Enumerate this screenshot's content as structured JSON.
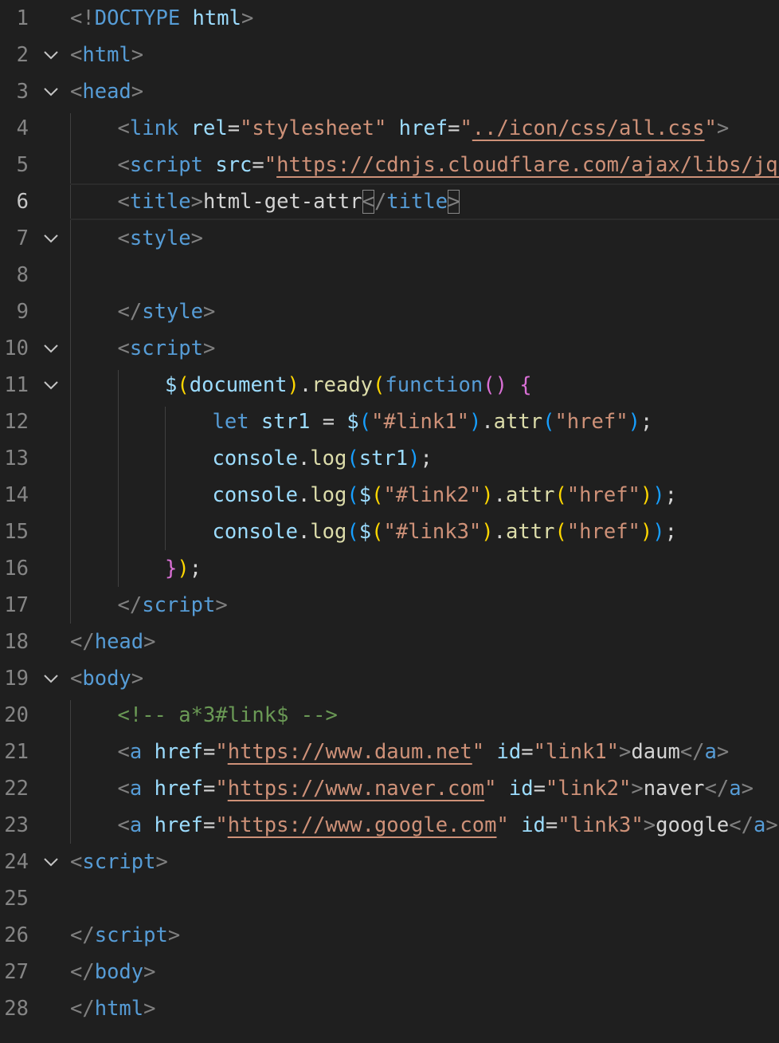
{
  "editor": {
    "active_line": 6,
    "lines": [
      {
        "n": "1",
        "fold": false,
        "indent": 0,
        "tokens": [
          [
            "p",
            "<!"
          ],
          [
            "tag",
            "DOCTYPE"
          ],
          [
            "txt",
            " "
          ],
          [
            "attr",
            "html"
          ],
          [
            "p",
            ">"
          ]
        ]
      },
      {
        "n": "2",
        "fold": true,
        "indent": 0,
        "tokens": [
          [
            "p",
            "<"
          ],
          [
            "tag",
            "html"
          ],
          [
            "p",
            ">"
          ]
        ]
      },
      {
        "n": "3",
        "fold": true,
        "indent": 0,
        "tokens": [
          [
            "p",
            "<"
          ],
          [
            "tag",
            "head"
          ],
          [
            "p",
            ">"
          ]
        ]
      },
      {
        "n": "4",
        "fold": false,
        "indent": 1,
        "tokens": [
          [
            "p",
            "<"
          ],
          [
            "tag",
            "link"
          ],
          [
            "txt",
            " "
          ],
          [
            "attr",
            "rel"
          ],
          [
            "txt",
            "="
          ],
          [
            "str",
            "\"stylesheet\""
          ],
          [
            "txt",
            " "
          ],
          [
            "attr",
            "href"
          ],
          [
            "txt",
            "="
          ],
          [
            "str",
            "\""
          ],
          [
            "url",
            "../icon/css/all.css"
          ],
          [
            "str",
            "\""
          ],
          [
            "p",
            ">"
          ]
        ]
      },
      {
        "n": "5",
        "fold": false,
        "indent": 1,
        "tokens": [
          [
            "p",
            "<"
          ],
          [
            "tag",
            "script"
          ],
          [
            "txt",
            " "
          ],
          [
            "attr",
            "src"
          ],
          [
            "txt",
            "="
          ],
          [
            "str",
            "\""
          ],
          [
            "url",
            "https://cdnjs.cloudflare.com/ajax/libs/jque"
          ]
        ]
      },
      {
        "n": "6",
        "fold": false,
        "indent": 1,
        "tokens": [
          [
            "p",
            "<"
          ],
          [
            "tag",
            "title"
          ],
          [
            "p",
            ">"
          ],
          [
            "txt",
            "html-get-attr"
          ],
          [
            "pm",
            "<"
          ],
          [
            "p",
            "/"
          ],
          [
            "tag",
            "title"
          ],
          [
            "pm",
            ">"
          ]
        ]
      },
      {
        "n": "7",
        "fold": true,
        "indent": 1,
        "tokens": [
          [
            "p",
            "<"
          ],
          [
            "tag",
            "style"
          ],
          [
            "p",
            ">"
          ]
        ]
      },
      {
        "n": "8",
        "fold": false,
        "indent": 1,
        "tokens": []
      },
      {
        "n": "9",
        "fold": false,
        "indent": 1,
        "tokens": [
          [
            "p",
            "</"
          ],
          [
            "tag",
            "style"
          ],
          [
            "p",
            ">"
          ]
        ]
      },
      {
        "n": "10",
        "fold": true,
        "indent": 1,
        "tokens": [
          [
            "p",
            "<"
          ],
          [
            "tag",
            "script"
          ],
          [
            "p",
            ">"
          ]
        ]
      },
      {
        "n": "11",
        "fold": true,
        "indent": 2,
        "tokens": [
          [
            "attr",
            "$"
          ],
          [
            "br1",
            "("
          ],
          [
            "attr",
            "document"
          ],
          [
            "br1",
            ")"
          ],
          [
            "txt",
            "."
          ],
          [
            "fn",
            "ready"
          ],
          [
            "br1",
            "("
          ],
          [
            "kw",
            "function"
          ],
          [
            "br2",
            "()"
          ],
          [
            "txt",
            " "
          ],
          [
            "br2",
            "{"
          ]
        ]
      },
      {
        "n": "12",
        "fold": false,
        "indent": 3,
        "tokens": [
          [
            "kw",
            "let"
          ],
          [
            "txt",
            " "
          ],
          [
            "attr",
            "str1"
          ],
          [
            "txt",
            " = "
          ],
          [
            "attr",
            "$"
          ],
          [
            "br3",
            "("
          ],
          [
            "str",
            "\"#link1\""
          ],
          [
            "br3",
            ")"
          ],
          [
            "txt",
            "."
          ],
          [
            "fn",
            "attr"
          ],
          [
            "br3",
            "("
          ],
          [
            "str",
            "\"href\""
          ],
          [
            "br3",
            ")"
          ],
          [
            "txt",
            ";"
          ]
        ]
      },
      {
        "n": "13",
        "fold": false,
        "indent": 3,
        "tokens": [
          [
            "attr",
            "console"
          ],
          [
            "txt",
            "."
          ],
          [
            "fn",
            "log"
          ],
          [
            "br3",
            "("
          ],
          [
            "attr",
            "str1"
          ],
          [
            "br3",
            ")"
          ],
          [
            "txt",
            ";"
          ]
        ]
      },
      {
        "n": "14",
        "fold": false,
        "indent": 3,
        "tokens": [
          [
            "attr",
            "console"
          ],
          [
            "txt",
            "."
          ],
          [
            "fn",
            "log"
          ],
          [
            "br3",
            "("
          ],
          [
            "attr",
            "$"
          ],
          [
            "br1",
            "("
          ],
          [
            "str",
            "\"#link2\""
          ],
          [
            "br1",
            ")"
          ],
          [
            "txt",
            "."
          ],
          [
            "fn",
            "attr"
          ],
          [
            "br1",
            "("
          ],
          [
            "str",
            "\"href\""
          ],
          [
            "br1",
            ")"
          ],
          [
            "br3",
            ")"
          ],
          [
            "txt",
            ";"
          ]
        ]
      },
      {
        "n": "15",
        "fold": false,
        "indent": 3,
        "tokens": [
          [
            "attr",
            "console"
          ],
          [
            "txt",
            "."
          ],
          [
            "fn",
            "log"
          ],
          [
            "br3",
            "("
          ],
          [
            "attr",
            "$"
          ],
          [
            "br1",
            "("
          ],
          [
            "str",
            "\"#link3\""
          ],
          [
            "br1",
            ")"
          ],
          [
            "txt",
            "."
          ],
          [
            "fn",
            "attr"
          ],
          [
            "br1",
            "("
          ],
          [
            "str",
            "\"href\""
          ],
          [
            "br1",
            ")"
          ],
          [
            "br3",
            ")"
          ],
          [
            "txt",
            ";"
          ]
        ]
      },
      {
        "n": "16",
        "fold": false,
        "indent": 2,
        "tokens": [
          [
            "br2",
            "}"
          ],
          [
            "br1",
            ")"
          ],
          [
            "txt",
            ";"
          ]
        ]
      },
      {
        "n": "17",
        "fold": false,
        "indent": 1,
        "tokens": [
          [
            "p",
            "</"
          ],
          [
            "tag",
            "script"
          ],
          [
            "p",
            ">"
          ]
        ]
      },
      {
        "n": "18",
        "fold": false,
        "indent": 0,
        "tokens": [
          [
            "p",
            "</"
          ],
          [
            "tag",
            "head"
          ],
          [
            "p",
            ">"
          ]
        ]
      },
      {
        "n": "19",
        "fold": true,
        "indent": 0,
        "tokens": [
          [
            "p",
            "<"
          ],
          [
            "tag",
            "body"
          ],
          [
            "p",
            ">"
          ]
        ]
      },
      {
        "n": "20",
        "fold": false,
        "indent": 1,
        "tokens": [
          [
            "cmt",
            "<!-- a*3#link$ -->"
          ]
        ]
      },
      {
        "n": "21",
        "fold": false,
        "indent": 1,
        "tokens": [
          [
            "p",
            "<"
          ],
          [
            "tag",
            "a"
          ],
          [
            "txt",
            " "
          ],
          [
            "attr",
            "href"
          ],
          [
            "txt",
            "="
          ],
          [
            "str",
            "\""
          ],
          [
            "url",
            "https://www.daum.net"
          ],
          [
            "str",
            "\""
          ],
          [
            "txt",
            " "
          ],
          [
            "attr",
            "id"
          ],
          [
            "txt",
            "="
          ],
          [
            "str",
            "\"link1\""
          ],
          [
            "p",
            ">"
          ],
          [
            "txt",
            "daum"
          ],
          [
            "p",
            "</"
          ],
          [
            "tag",
            "a"
          ],
          [
            "p",
            ">"
          ]
        ]
      },
      {
        "n": "22",
        "fold": false,
        "indent": 1,
        "tokens": [
          [
            "p",
            "<"
          ],
          [
            "tag",
            "a"
          ],
          [
            "txt",
            " "
          ],
          [
            "attr",
            "href"
          ],
          [
            "txt",
            "="
          ],
          [
            "str",
            "\""
          ],
          [
            "url",
            "https://www.naver.com"
          ],
          [
            "str",
            "\""
          ],
          [
            "txt",
            " "
          ],
          [
            "attr",
            "id"
          ],
          [
            "txt",
            "="
          ],
          [
            "str",
            "\"link2\""
          ],
          [
            "p",
            ">"
          ],
          [
            "txt",
            "naver"
          ],
          [
            "p",
            "</"
          ],
          [
            "tag",
            "a"
          ],
          [
            "p",
            ">"
          ]
        ]
      },
      {
        "n": "23",
        "fold": false,
        "indent": 1,
        "tokens": [
          [
            "p",
            "<"
          ],
          [
            "tag",
            "a"
          ],
          [
            "txt",
            " "
          ],
          [
            "attr",
            "href"
          ],
          [
            "txt",
            "="
          ],
          [
            "str",
            "\""
          ],
          [
            "url",
            "https://www.google.com"
          ],
          [
            "str",
            "\""
          ],
          [
            "txt",
            " "
          ],
          [
            "attr",
            "id"
          ],
          [
            "txt",
            "="
          ],
          [
            "str",
            "\"link3\""
          ],
          [
            "p",
            ">"
          ],
          [
            "txt",
            "google"
          ],
          [
            "p",
            "</"
          ],
          [
            "tag",
            "a"
          ],
          [
            "p",
            ">"
          ]
        ]
      },
      {
        "n": "24",
        "fold": true,
        "indent": 0,
        "tokens": [
          [
            "p",
            "<"
          ],
          [
            "tag",
            "script"
          ],
          [
            "p",
            ">"
          ]
        ]
      },
      {
        "n": "25",
        "fold": false,
        "indent": 0,
        "tokens": []
      },
      {
        "n": "26",
        "fold": false,
        "indent": 0,
        "tokens": [
          [
            "p",
            "</"
          ],
          [
            "tag",
            "script"
          ],
          [
            "p",
            ">"
          ]
        ]
      },
      {
        "n": "27",
        "fold": false,
        "indent": 0,
        "tokens": [
          [
            "p",
            "</"
          ],
          [
            "tag",
            "body"
          ],
          [
            "p",
            ">"
          ]
        ]
      },
      {
        "n": "28",
        "fold": false,
        "indent": 0,
        "tokens": [
          [
            "p",
            "</"
          ],
          [
            "tag",
            "html"
          ],
          [
            "p",
            ">"
          ]
        ]
      }
    ]
  }
}
